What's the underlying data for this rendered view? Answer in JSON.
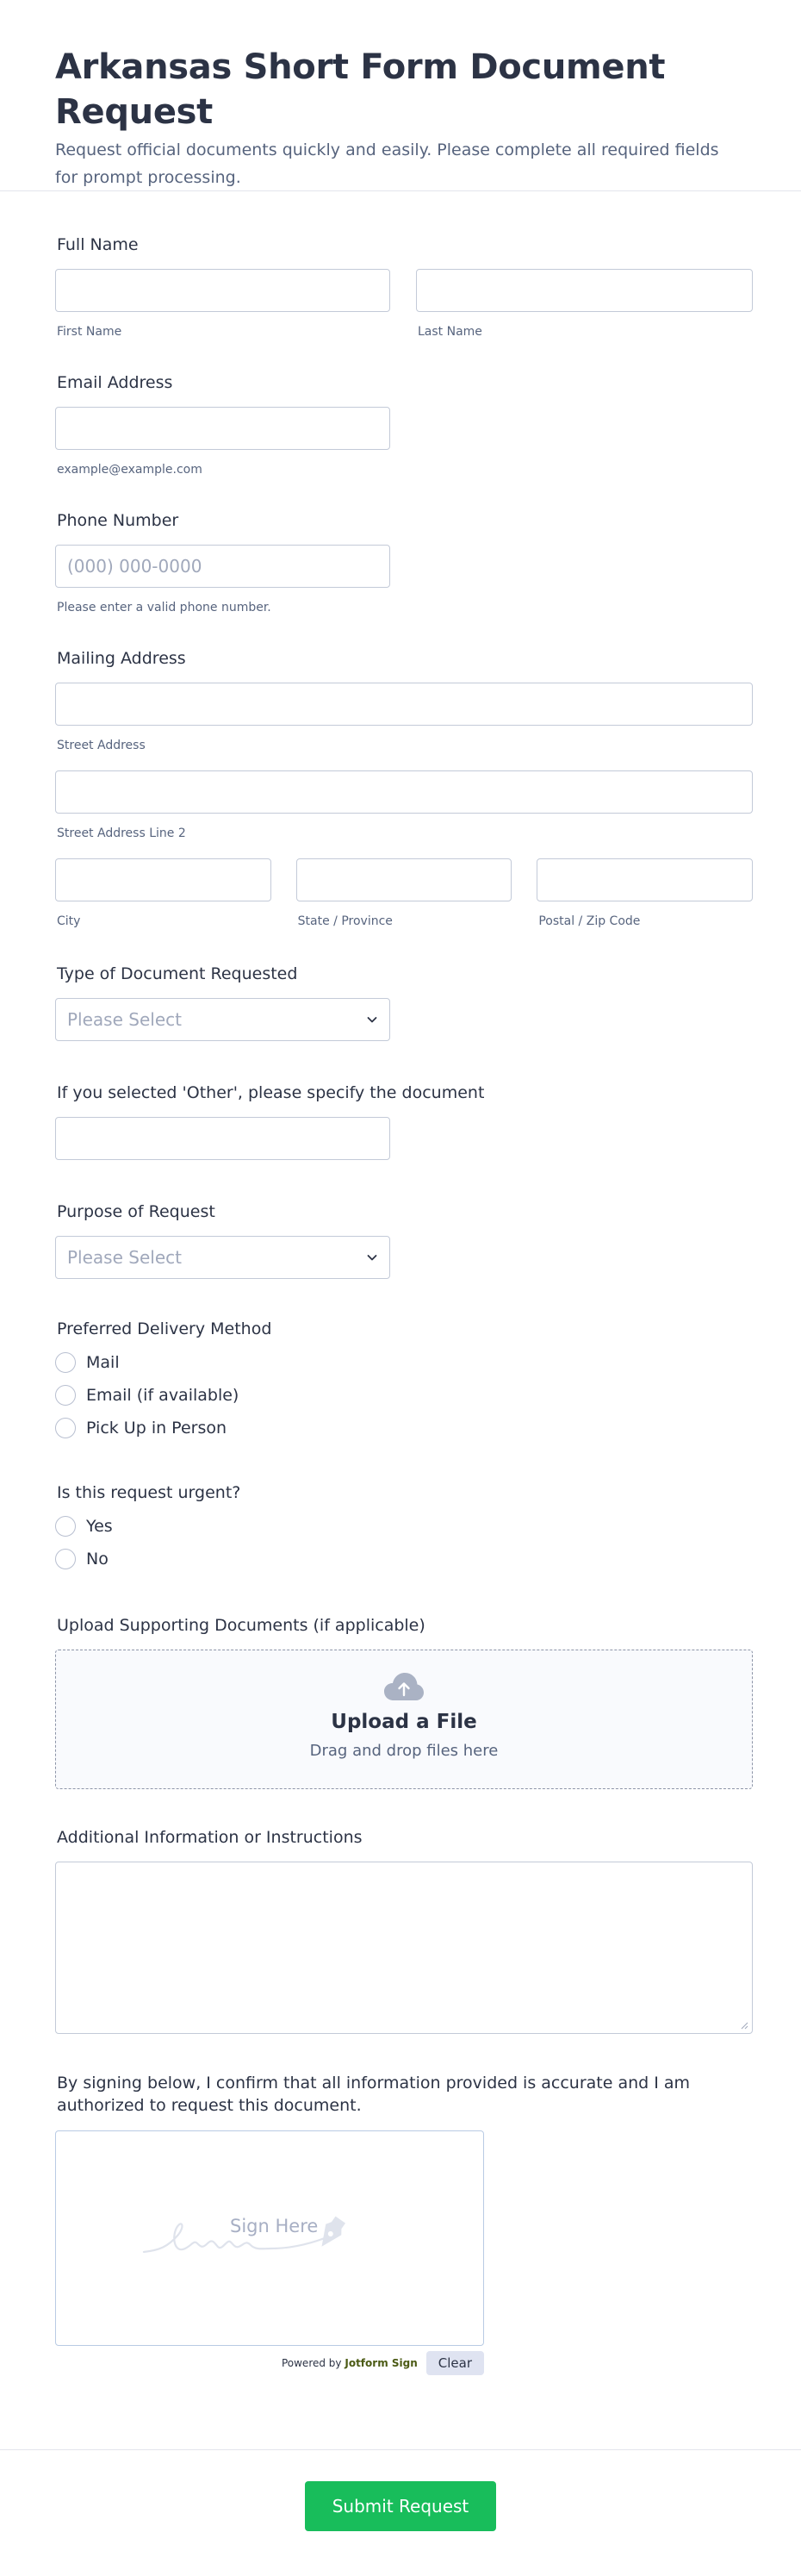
{
  "header": {
    "title": "Arkansas Short Form Document Request",
    "description": "Request official documents quickly and easily. Please complete all required fields for prompt processing."
  },
  "full_name": {
    "label": "Full Name",
    "first_sub": "First Name",
    "last_sub": "Last Name"
  },
  "email": {
    "label": "Email Address",
    "sub": "example@example.com"
  },
  "phone": {
    "label": "Phone Number",
    "placeholder": "(000) 000-0000",
    "sub": "Please enter a valid phone number."
  },
  "address": {
    "label": "Mailing Address",
    "street_sub": "Street Address",
    "street2_sub": "Street Address Line 2",
    "city_sub": "City",
    "state_sub": "State / Province",
    "zip_sub": "Postal / Zip Code"
  },
  "doc_type": {
    "label": "Type of Document Requested",
    "selected": "Please Select"
  },
  "other_doc": {
    "label": "If you selected 'Other', please specify the document"
  },
  "purpose": {
    "label": "Purpose of Request",
    "selected": "Please Select"
  },
  "delivery": {
    "label": "Preferred Delivery Method",
    "options": [
      "Mail",
      "Email (if available)",
      "Pick Up in Person"
    ]
  },
  "urgent": {
    "label": "Is this request urgent?",
    "options": [
      "Yes",
      "No"
    ]
  },
  "upload": {
    "label": "Upload Supporting Documents (if applicable)",
    "title": "Upload a File",
    "sub": "Drag and drop files here"
  },
  "additional": {
    "label": "Additional Information or Instructions"
  },
  "signature": {
    "label": "By signing below, I confirm that all information provided is accurate and I am authorized to request this document.",
    "placeholder": "Sign Here",
    "powered_prefix": "Powered by",
    "powered_brand": "Jotform Sign",
    "clear_label": "Clear"
  },
  "submit": {
    "label": "Submit Request"
  },
  "colors": {
    "accent": "#18bd5b",
    "text": "#2c3345",
    "muted": "#57647e",
    "border": "#c3cad8"
  },
  "icons": {
    "upload": "cloud-upload-icon",
    "select": "chevron-down-icon",
    "signature": "pen-nib-icon"
  }
}
